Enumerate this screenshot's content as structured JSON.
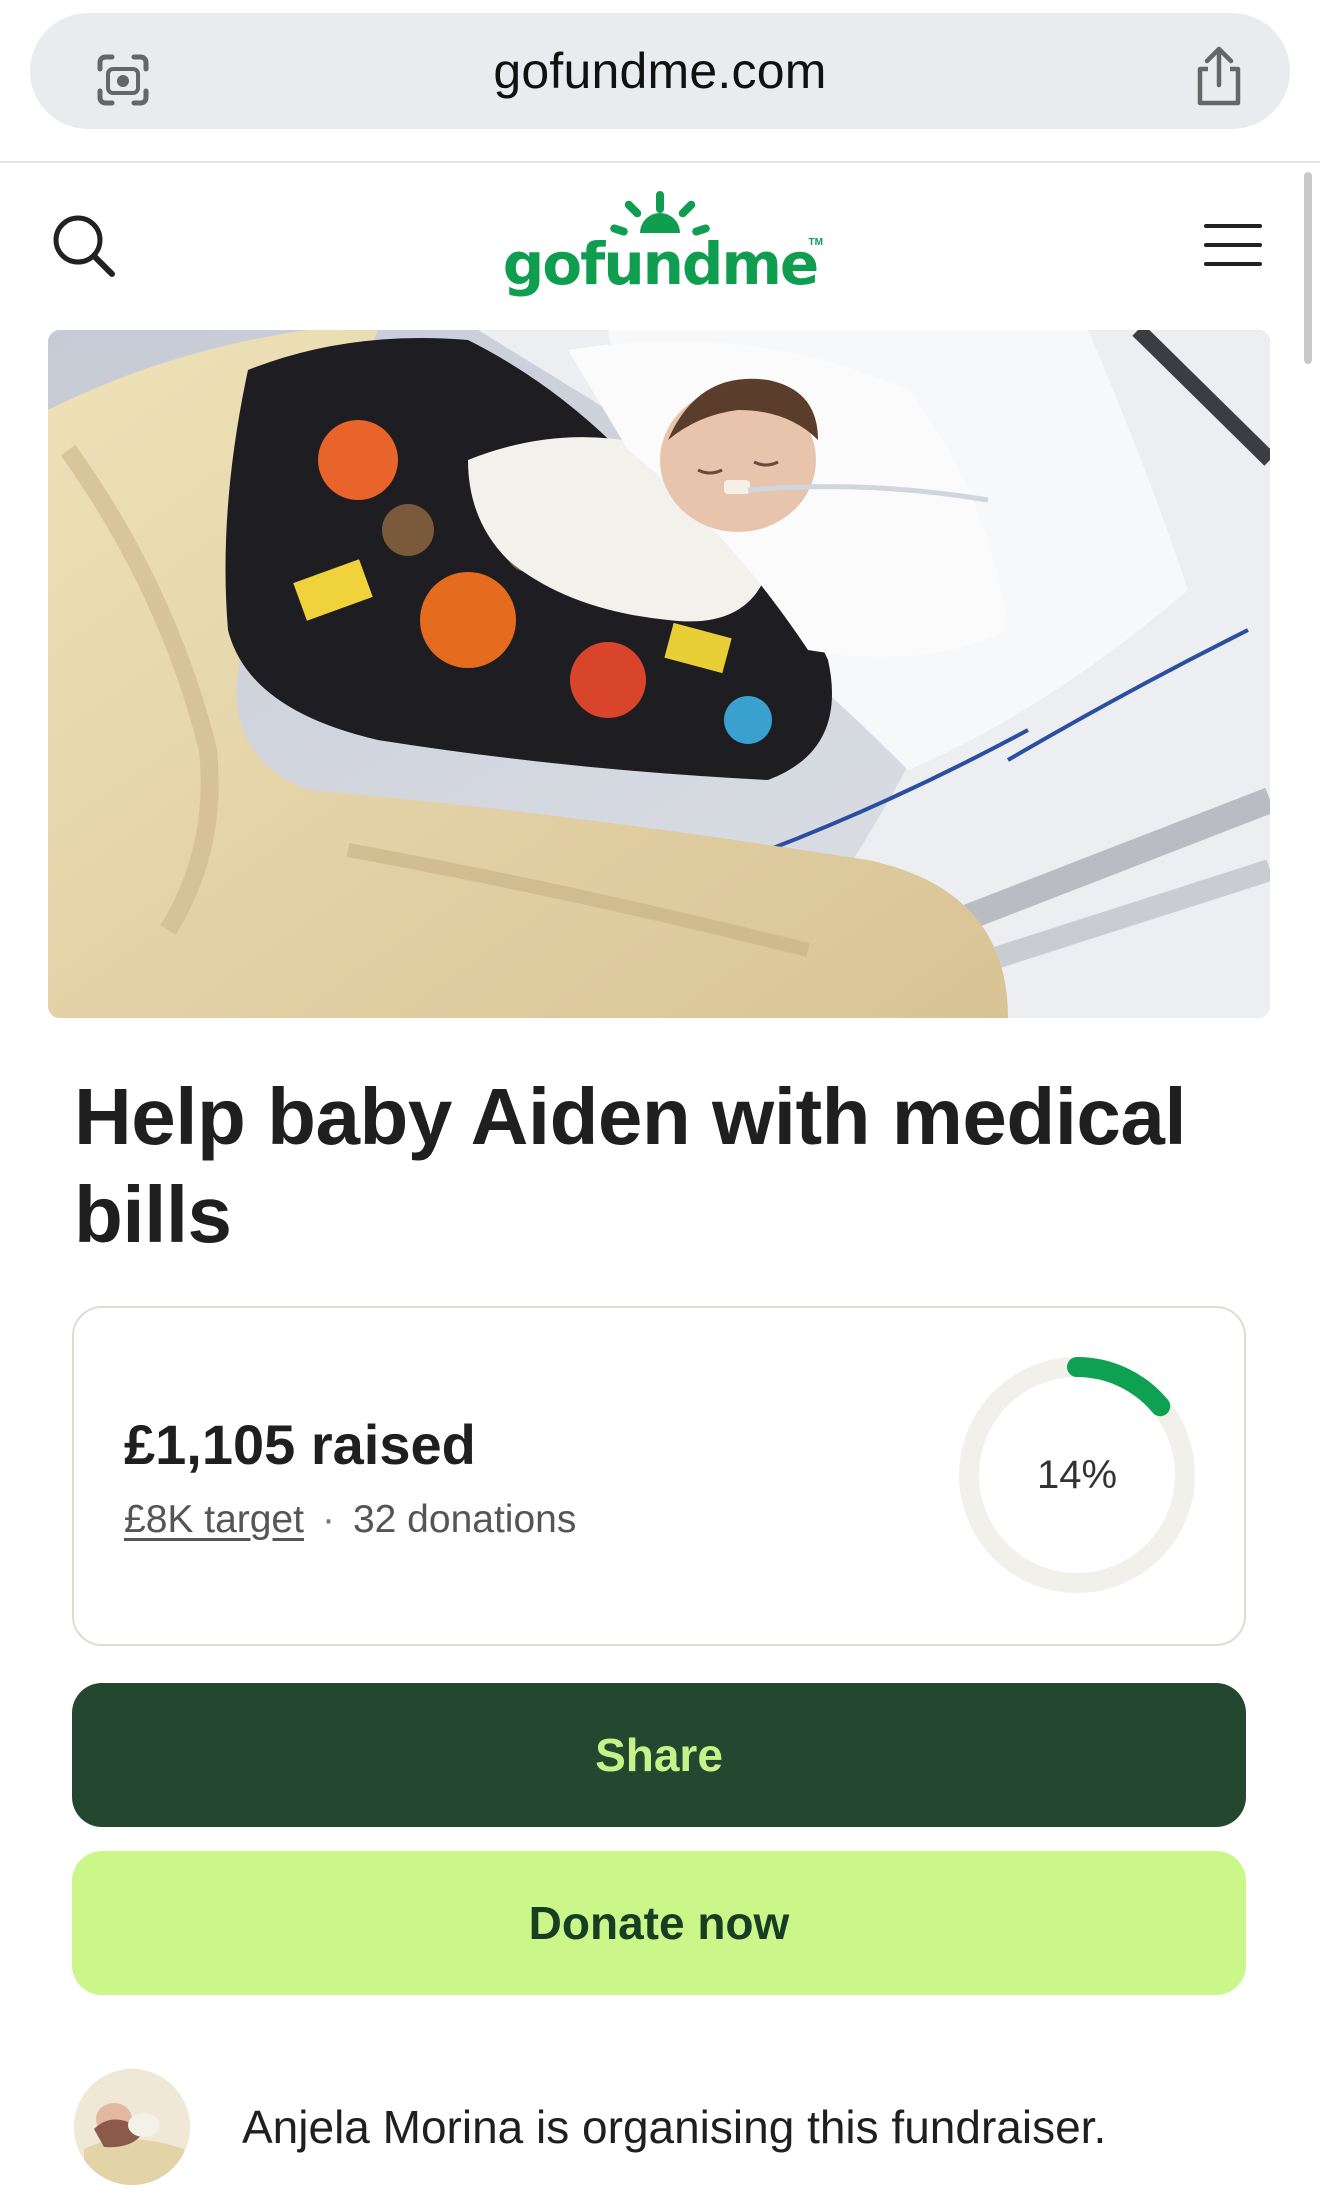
{
  "browser": {
    "url": "gofundme.com",
    "lens_icon": "camera-lens-icon",
    "share_icon": "share-icon"
  },
  "header": {
    "search_icon": "search-icon",
    "logo_text": "gofundme",
    "logo_tm": "TM",
    "menu_icon": "hamburger-menu-icon",
    "brand_color": "#0f9e4f"
  },
  "fundraiser": {
    "title": "Help baby Aiden with medical bills",
    "raised": "£1,105 raised",
    "target": "£8K target",
    "separator": "·",
    "donations": "32 donations",
    "progress_label": "14%",
    "progress_fraction": 0.14,
    "progress_color": "#0fa152",
    "track_color": "#f2f0eb"
  },
  "actions": {
    "share_label": "Share",
    "donate_label": "Donate now",
    "share_bg": "#24472f",
    "donate_bg": "#cbf78a"
  },
  "organiser": {
    "text": "Anjela Morina is organising this fundraiser."
  }
}
